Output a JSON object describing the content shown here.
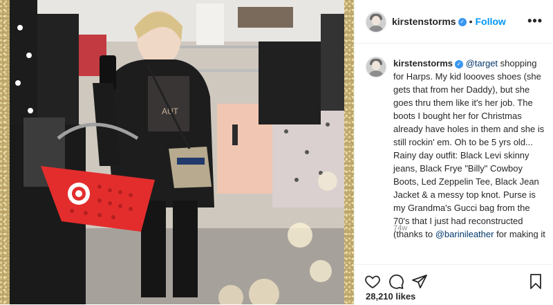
{
  "post": {
    "username": "kirstenstorms",
    "follow_label": "Follow",
    "separator": "•",
    "more_label": "•••",
    "caption": {
      "mention1": "@target",
      "text1": " shopping for Harps. My kid loooves shoes (she gets that from her Daddy), but she goes thru them like it's her job. The boots I bought her for Christmas already have holes in them and she is still rockin' em. Oh to be 5 yrs old... Rainy day outfit: Black Levi skinny jeans, Black Frye \"Billy\" Cowboy Boots, Led Zeppelin Tee, Black Jean Jacket & a messy top knot. Purse is my Grandma's Gucci bag from the 70's that I just had reconstructed (thanks to ",
      "mention2": "@barinileather",
      "text2": " for making it look new again! 🙌🏻)."
    },
    "time_ago": "74w",
    "add_comment_label": "+",
    "likes": "28,210 likes"
  },
  "icons": {
    "verified": "verified-badge-icon",
    "like": "heart-icon",
    "comment": "comment-icon",
    "share": "share-icon",
    "save": "bookmark-icon",
    "add": "plus-circle-icon"
  },
  "colors": {
    "link": "#00376b",
    "follow": "#0095f6",
    "verified": "#3897f0",
    "secondary_text": "#8e8e8e",
    "basket": "#e32d2d"
  }
}
